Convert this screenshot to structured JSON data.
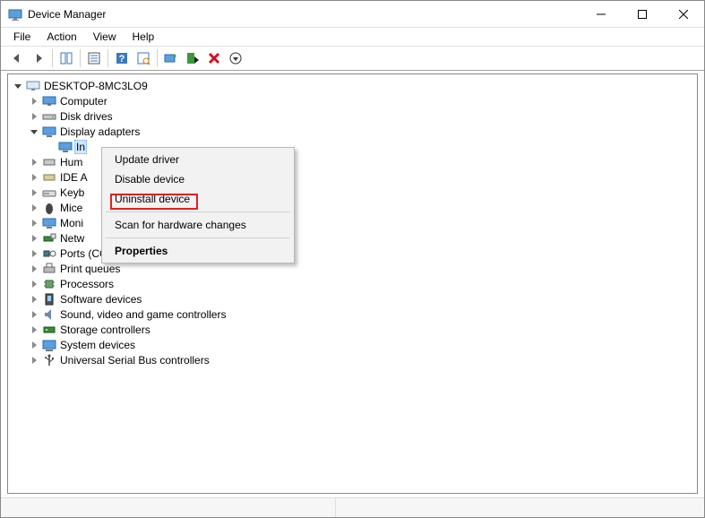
{
  "window": {
    "title": "Device Manager"
  },
  "menubar": [
    "File",
    "Action",
    "View",
    "Help"
  ],
  "tree": {
    "root": "DESKTOP-8MC3LO9",
    "nodes": [
      "Computer",
      "Disk drives",
      "Display adapters",
      "In",
      "Hum",
      "IDE A",
      "Keyb",
      "Mice",
      "Moni",
      "Netw",
      "Ports (COM & LPT)",
      "Print queues",
      "Processors",
      "Software devices",
      "Sound, video and game controllers",
      "Storage controllers",
      "System devices",
      "Universal Serial Bus controllers"
    ]
  },
  "context_menu": {
    "update": "Update driver",
    "disable": "Disable device",
    "uninstall": "Uninstall device",
    "scan": "Scan for hardware changes",
    "properties": "Properties"
  }
}
